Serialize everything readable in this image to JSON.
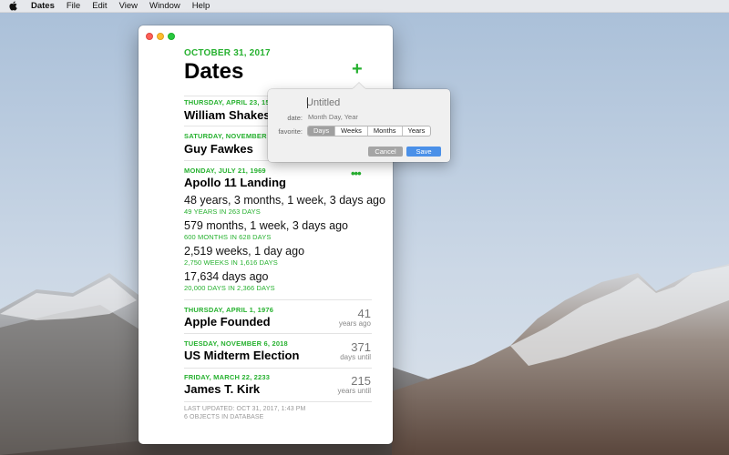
{
  "menubar": {
    "app_name": "Dates",
    "items": [
      "File",
      "Edit",
      "View",
      "Window",
      "Help"
    ]
  },
  "window": {
    "current_date": "OCTOBER 31, 2017",
    "title": "Dates",
    "add_button": "+",
    "more_button": "•••",
    "entries": [
      {
        "date": "THURSDAY, APRIL 23, 1564",
        "name": "William Shakespeare"
      },
      {
        "date": "SATURDAY, NOVEMBER 05, 1605",
        "name": "Guy Fawkes"
      },
      {
        "date": "MONDAY, JULY 21, 1969",
        "name": "Apollo 11 Landing",
        "stats": [
          {
            "main": "48 years, 3 months, 1 week, 3 days ago",
            "sub": "49 YEARS IN 263 DAYS"
          },
          {
            "main": "579 months, 1 week, 3 days ago",
            "sub": "600 MONTHS IN 628 DAYS"
          },
          {
            "main": "2,519 weeks, 1 day ago",
            "sub": "2,750 WEEKS IN 1,616 DAYS"
          },
          {
            "main": "17,634 days ago",
            "sub": "20,000 DAYS IN 2,366 DAYS"
          }
        ]
      },
      {
        "date": "THURSDAY, APRIL 1, 1976",
        "name": "Apple Founded",
        "count": "41",
        "count_label": "years ago"
      },
      {
        "date": "TUESDAY, NOVEMBER 6, 2018",
        "name": "US Midterm Election",
        "count": "371",
        "count_label": "days until"
      },
      {
        "date": "FRIDAY, MARCH 22, 2233",
        "name": "James T. Kirk",
        "count": "215",
        "count_label": "years until"
      }
    ],
    "footer": {
      "line1": "LAST UPDATED: OCT 31, 2017, 1:43 PM",
      "line2": "6 OBJECTS IN DATABASE"
    }
  },
  "popover": {
    "title_placeholder": "Untitled",
    "date_label": "date:",
    "date_placeholder": "Month Day, Year",
    "favorite_label": "favorite:",
    "segments": [
      "Days",
      "Weeks",
      "Months",
      "Years"
    ],
    "selected_segment": "Days",
    "cancel_label": "Cancel",
    "save_label": "Save"
  },
  "colors": {
    "accent_green": "#26b12f",
    "save_blue": "#4a90e8"
  }
}
